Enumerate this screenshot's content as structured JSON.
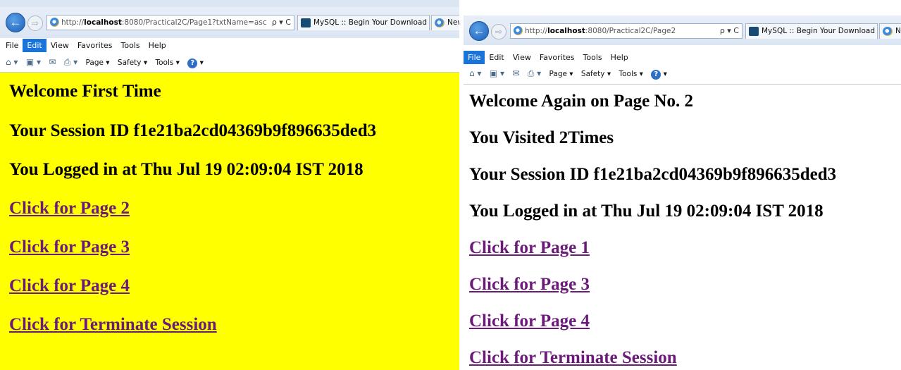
{
  "left_window": {
    "url_prefix": "http://",
    "url_host": "localhost",
    "url_rest": ":8080/Practical2C/Page1?txtName=asc",
    "url_tools": "ρ ▾ C",
    "tabs": [
      {
        "label": "MySQL :: Begin Your Download"
      },
      {
        "label": "New"
      }
    ],
    "menu": [
      "File",
      "Edit",
      "View",
      "Favorites",
      "Tools",
      "Help"
    ],
    "active_menu": "Edit",
    "commands": [
      "Page ▾",
      "Safety ▾",
      "Tools ▾"
    ],
    "content": {
      "background": "#ffff00",
      "welcome": "Welcome First Time",
      "session": "Your Session ID f1e21ba2cd04369b9f896635ded3",
      "logged": "You Logged in at Thu Jul 19 02:09:04 IST 2018",
      "links": [
        "Click for Page 2",
        "Click for Page 3",
        "Click for Page 4",
        "Click for Terminate Session"
      ]
    }
  },
  "right_window": {
    "url_prefix": "http://",
    "url_host": "localhost",
    "url_rest": ":8080/Practical2C/Page2",
    "url_tools": "ρ ▾ C",
    "tabs": [
      {
        "label": "MySQL :: Begin Your Download"
      },
      {
        "label": "New tab"
      }
    ],
    "menu": [
      "File",
      "Edit",
      "View",
      "Favorites",
      "Tools",
      "Help"
    ],
    "active_menu": "File",
    "commands": [
      "Page ▾",
      "Safety ▾",
      "Tools ▾"
    ],
    "content": {
      "background": "#ffffff",
      "welcome": "Welcome Again on Page No. 2",
      "visited": "You Visited 2Times",
      "session": "Your Session ID f1e21ba2cd04369b9f896635ded3",
      "logged": "You Logged in at Thu Jul 19 02:09:04 IST 2018",
      "links": [
        "Click for Page 1",
        "Click for Page 3",
        "Click for Page 4",
        "Click for Terminate Session"
      ]
    }
  },
  "colors": {
    "link": "#6b1a7a",
    "highlight_menu": "#1a73d9"
  },
  "icons": [
    "back-arrow-icon",
    "forward-arrow-icon",
    "ie-page-icon",
    "mysql-icon",
    "home-icon",
    "feeds-icon",
    "mail-icon",
    "print-icon",
    "help-icon"
  ]
}
